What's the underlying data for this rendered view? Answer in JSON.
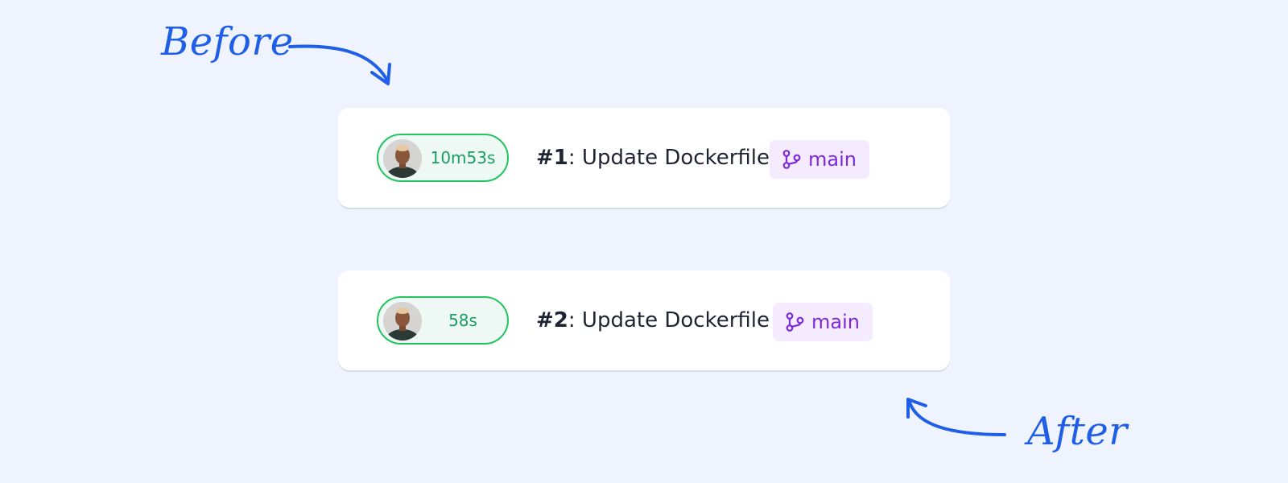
{
  "annotations": {
    "before": "Before",
    "after": "After"
  },
  "runs": [
    {
      "number": "#1",
      "title": ": Update Dockerfile",
      "duration": "10m53s",
      "branch": "main",
      "branch_icon": "git-branch-icon",
      "avatar_icon": "avatar"
    },
    {
      "number": "#2",
      "title": ": Update Dockerfile",
      "duration": "58s",
      "branch": "main",
      "branch_icon": "git-branch-icon",
      "avatar_icon": "avatar"
    }
  ],
  "colors": {
    "background": "#eef3fe",
    "annotation": "#1f5fe8",
    "success_border": "#22c55e",
    "success_text": "#1a9d63",
    "branch_bg": "#f4ebfe",
    "branch_text": "#7e2ad6"
  }
}
